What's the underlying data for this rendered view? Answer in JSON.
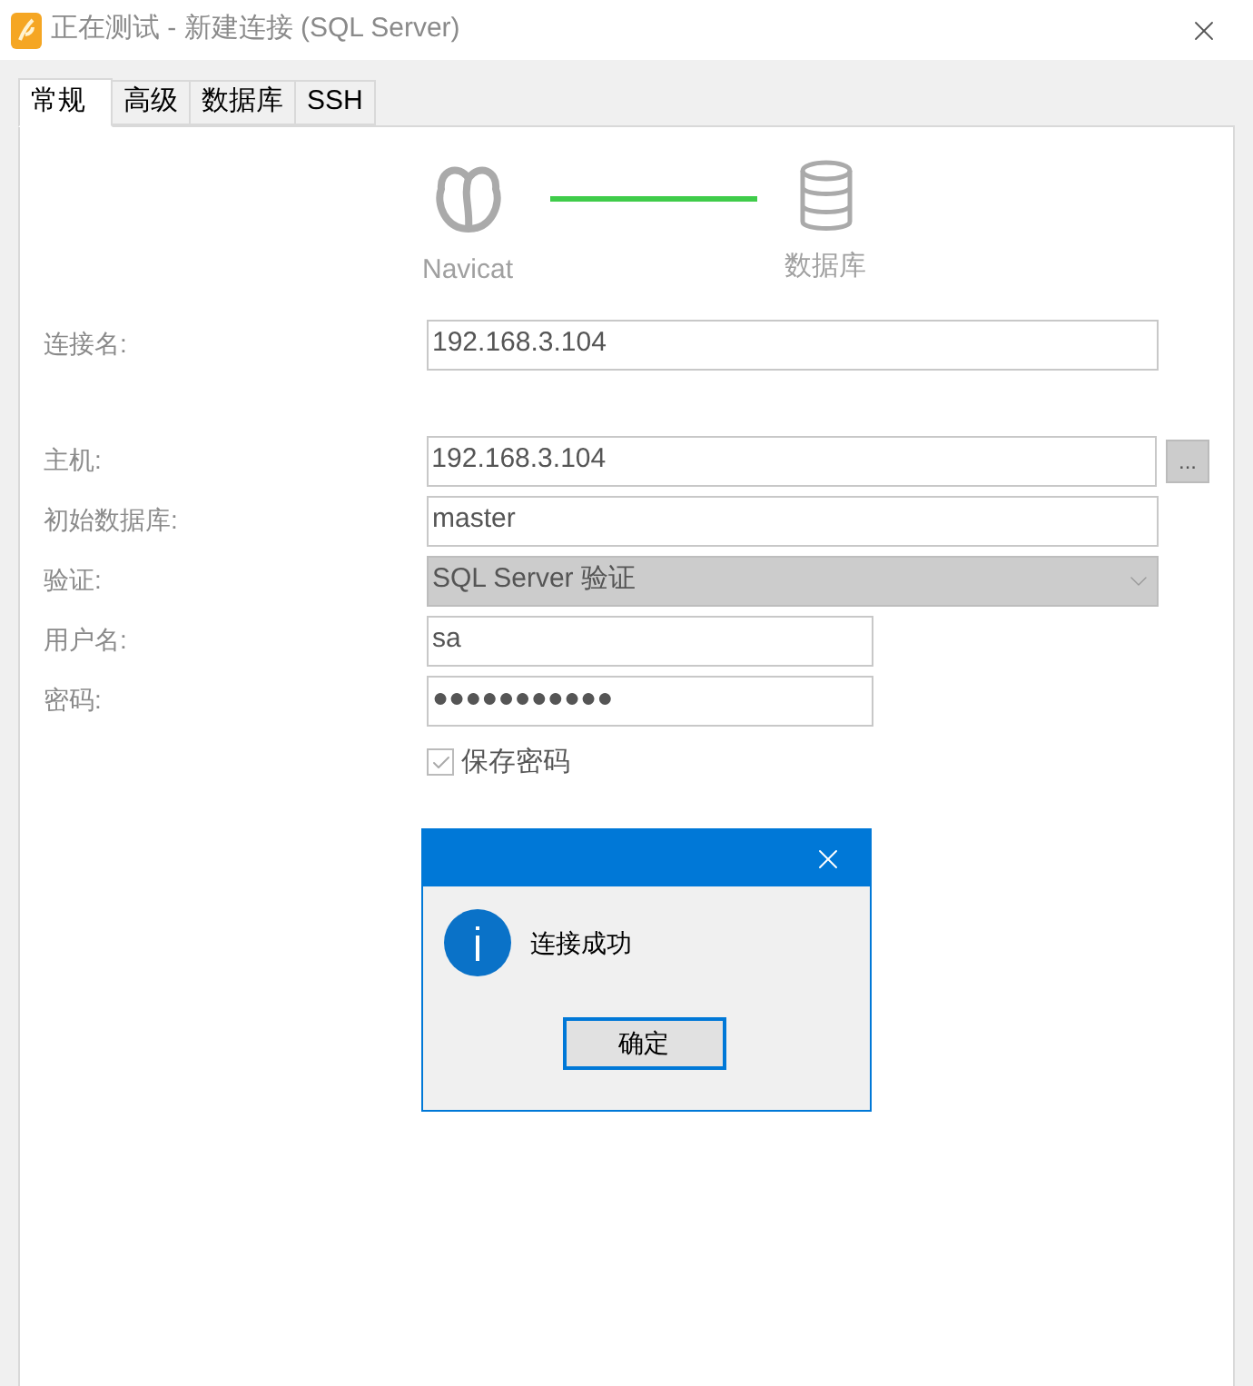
{
  "window": {
    "title": "正在测试 - 新建连接 (SQL Server)"
  },
  "tabs": [
    {
      "label": "常规",
      "selected": true
    },
    {
      "label": "高级",
      "selected": false
    },
    {
      "label": "数据库",
      "selected": false
    },
    {
      "label": "SSH",
      "selected": false
    }
  ],
  "diagram": {
    "left_label": "Navicat",
    "right_label": "数据库"
  },
  "fields": [
    {
      "kind": "text",
      "label": "连接名:",
      "value": "192.168.3.104",
      "disabled": false
    },
    {
      "kind": "text",
      "label": "主机:",
      "value": "192.168.3.104",
      "disabled": false,
      "browse": "..."
    },
    {
      "kind": "text",
      "label": "初始数据库:",
      "value": "master",
      "disabled": false
    },
    {
      "kind": "select",
      "label": "验证:",
      "value": "SQL Server 验证",
      "disabled": true
    },
    {
      "kind": "short",
      "label": "用户名:",
      "value": "sa",
      "disabled": false
    },
    {
      "kind": "short",
      "label": "密码:",
      "value": "●●●●●●●●●●●",
      "disabled": false
    }
  ],
  "save_password": {
    "label": "保存密码",
    "checked": true
  },
  "dialog": {
    "message": "连接成功",
    "button": "确定"
  }
}
